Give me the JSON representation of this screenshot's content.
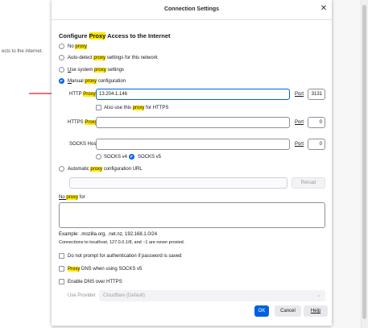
{
  "background": {
    "left_text": "ects to the internet."
  },
  "dialog": {
    "title": "Connection Settings",
    "close_icon": "close-icon",
    "heading": {
      "pre": "Configure ",
      "hl": "Proxy",
      "post": " Access to the Internet"
    },
    "options": {
      "no_proxy": {
        "pre": "No ",
        "hl": "proxy",
        "post": ""
      },
      "auto_detect": {
        "pre": "Auto-detect ",
        "hl": "proxy",
        "post": " settings for this network"
      },
      "system": {
        "u": "U",
        "pre": "se system ",
        "hl": "proxy",
        "post": " settings"
      },
      "manual": {
        "u": "M",
        "pre": "anual ",
        "hl": "proxy",
        "post": " configuration"
      }
    },
    "http": {
      "label_pre": "HTTP ",
      "label_hl": "Proxy",
      "value": "13.204.1.146",
      "port_label": "Port",
      "port_value": "3131"
    },
    "also_https": {
      "pre": "Also use this ",
      "hl": "proxy",
      "post": " for HTTPS"
    },
    "https": {
      "label_pre": "HTTPS ",
      "label_hl": "Proxy",
      "value": "",
      "port_label": "Port",
      "port_value": "0"
    },
    "socks": {
      "label": "SOCKS Host",
      "value": "",
      "port_label": "Port",
      "port_value": "0",
      "v4": "SOCKS v4",
      "v5": "SOCKS v5"
    },
    "auto_config": {
      "pre": "Automatic ",
      "hl": "proxy",
      "post": " configuration URL"
    },
    "reload": "Reload",
    "no_proxy_for": {
      "pre": "No ",
      "hl": "proxy",
      "post": " for"
    },
    "example": "Example: .mozilla.org, .net.nz, 192.168.1.0/24",
    "never_proxied": "Connections to localhost, 127.0.0.1/8, and ::1 are never proxied.",
    "no_prompt": "Do not prompt for authentication if password is saved",
    "proxy_dns": {
      "hl": "Proxy",
      "post": " DNS when using SOCKS v5"
    },
    "enable_doh": "Enable DNS over HTTPS",
    "use_provider": "Use Provider",
    "provider_value": "Cloudflare (Default)",
    "ok": "OK",
    "cancel": "Cancel",
    "help": "Help"
  },
  "annotation": {
    "color": "#e02020"
  },
  "colors": {
    "accent": "#0061e0",
    "highlight": "#ffe900"
  }
}
